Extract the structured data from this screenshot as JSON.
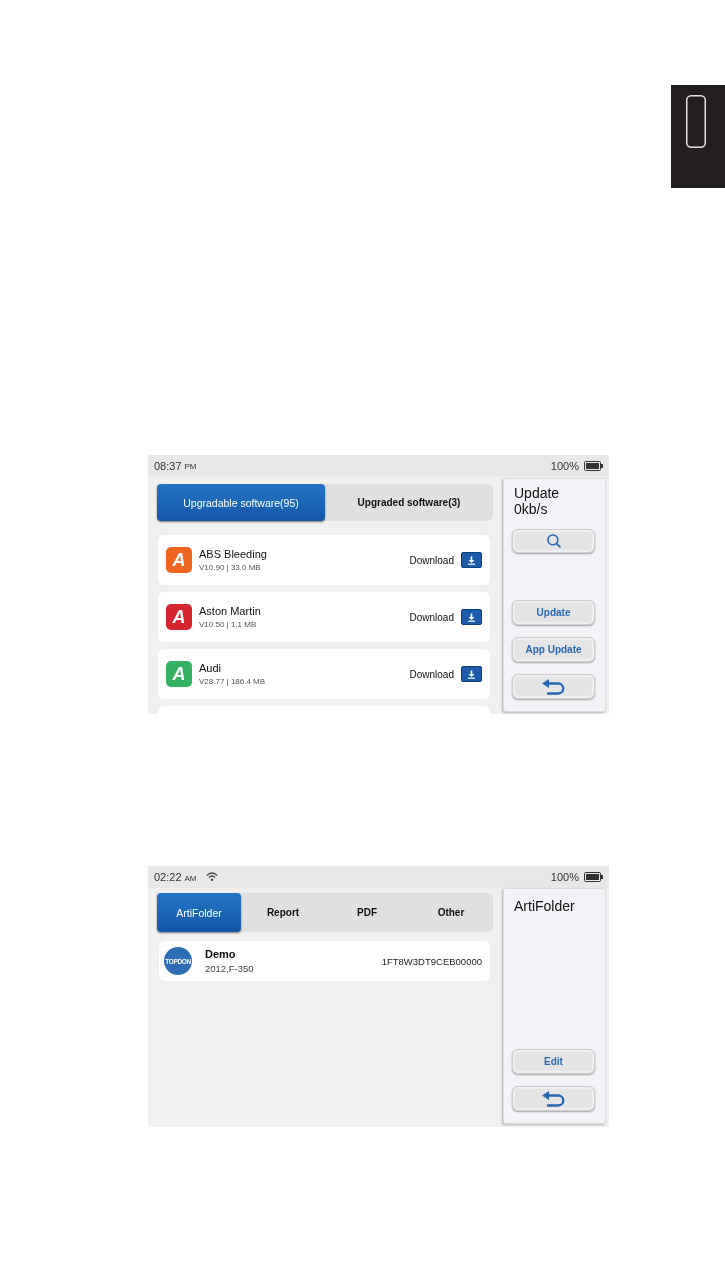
{
  "screens": [
    {
      "status_bar": {
        "time": "08:37",
        "meridiem": "PM",
        "battery": "100%"
      },
      "tabs": [
        {
          "label": "Upgradable software(95)",
          "selected": true
        },
        {
          "label": "Upgraded software(3)",
          "selected": false
        }
      ],
      "list": [
        {
          "kind": "software",
          "logo": "A",
          "color": "#f0651f",
          "name": "ABS Bleeding",
          "details": "V10.90 | 33.0 MB",
          "action": "Download"
        },
        {
          "kind": "software",
          "logo": "A",
          "color": "#d52630",
          "name": "Aston Martin",
          "details": "V10.50 | 1.1 MB",
          "action": "Download"
        },
        {
          "kind": "software",
          "logo": "A",
          "color": "#34b262",
          "name": "Audi",
          "details": "V28.77 | 186.4 MB",
          "action": "Download"
        },
        {
          "kind": "clipped"
        }
      ],
      "side_panel": {
        "title": "Update",
        "subtitle": "0kb/s",
        "top_buttons": [
          {
            "kind": "search"
          }
        ],
        "bottom_buttons": [
          {
            "kind": "text",
            "label": "Update"
          },
          {
            "kind": "text",
            "label": "App Update"
          },
          {
            "kind": "back"
          }
        ]
      }
    },
    {
      "status_bar": {
        "time": "02:22",
        "meridiem": "AM",
        "wifi": true,
        "battery": "100%"
      },
      "tabs": [
        {
          "label": "ArtiFolder",
          "selected": true
        },
        {
          "label": "Report",
          "selected": false
        },
        {
          "label": "PDF",
          "selected": false
        },
        {
          "label": "Other",
          "selected": false
        }
      ],
      "list": [
        {
          "kind": "vehicle",
          "logo": "TOPDON",
          "name": "Demo",
          "details": "2012,F-350",
          "vin": "1FT8W3DT9CEB00000"
        }
      ],
      "side_panel": {
        "title": "ArtiFolder",
        "bottom_buttons": [
          {
            "kind": "text",
            "label": "Edit"
          },
          {
            "kind": "back"
          }
        ]
      }
    }
  ]
}
